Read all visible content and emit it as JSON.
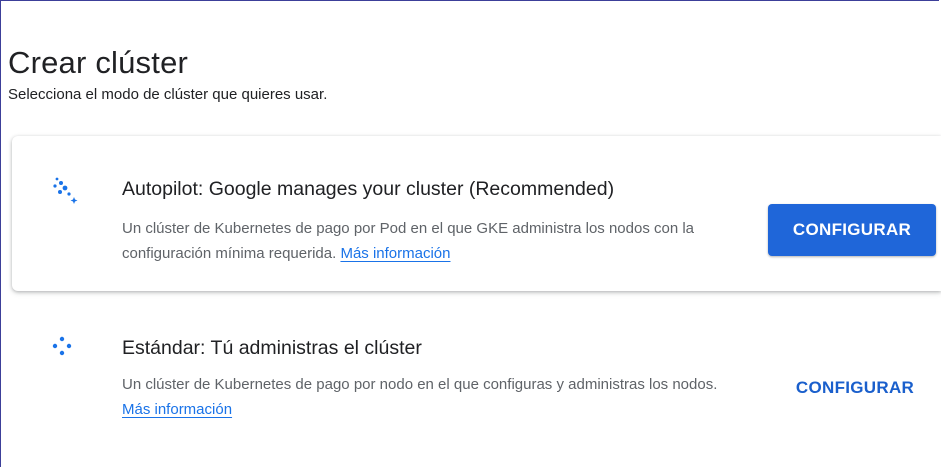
{
  "page": {
    "title": "Crear clúster",
    "subtitle": "Selecciona el modo de clúster que quieres usar."
  },
  "options": [
    {
      "title": "Autopilot: Google manages your cluster (Recommended)",
      "description": "Un clúster de Kubernetes de pago por Pod en el que GKE administra los nodos con la configuración mínima requerida.",
      "link_label": "Más información",
      "button_label": "CONFIGURAR",
      "icon": "autopilot-sparkle-icon"
    },
    {
      "title": "Estándar: Tú administras el clúster",
      "description": "Un clúster de Kubernetes de pago por nodo en el que configuras y administras los nodos.",
      "link_label": "Más información",
      "button_label": "CONFIGURAR",
      "icon": "standard-dots-icon"
    }
  ],
  "colors": {
    "accent": "#1a73e8",
    "primary_button": "#1f66d9",
    "text": "#202124",
    "secondary_text": "#5f6368"
  }
}
